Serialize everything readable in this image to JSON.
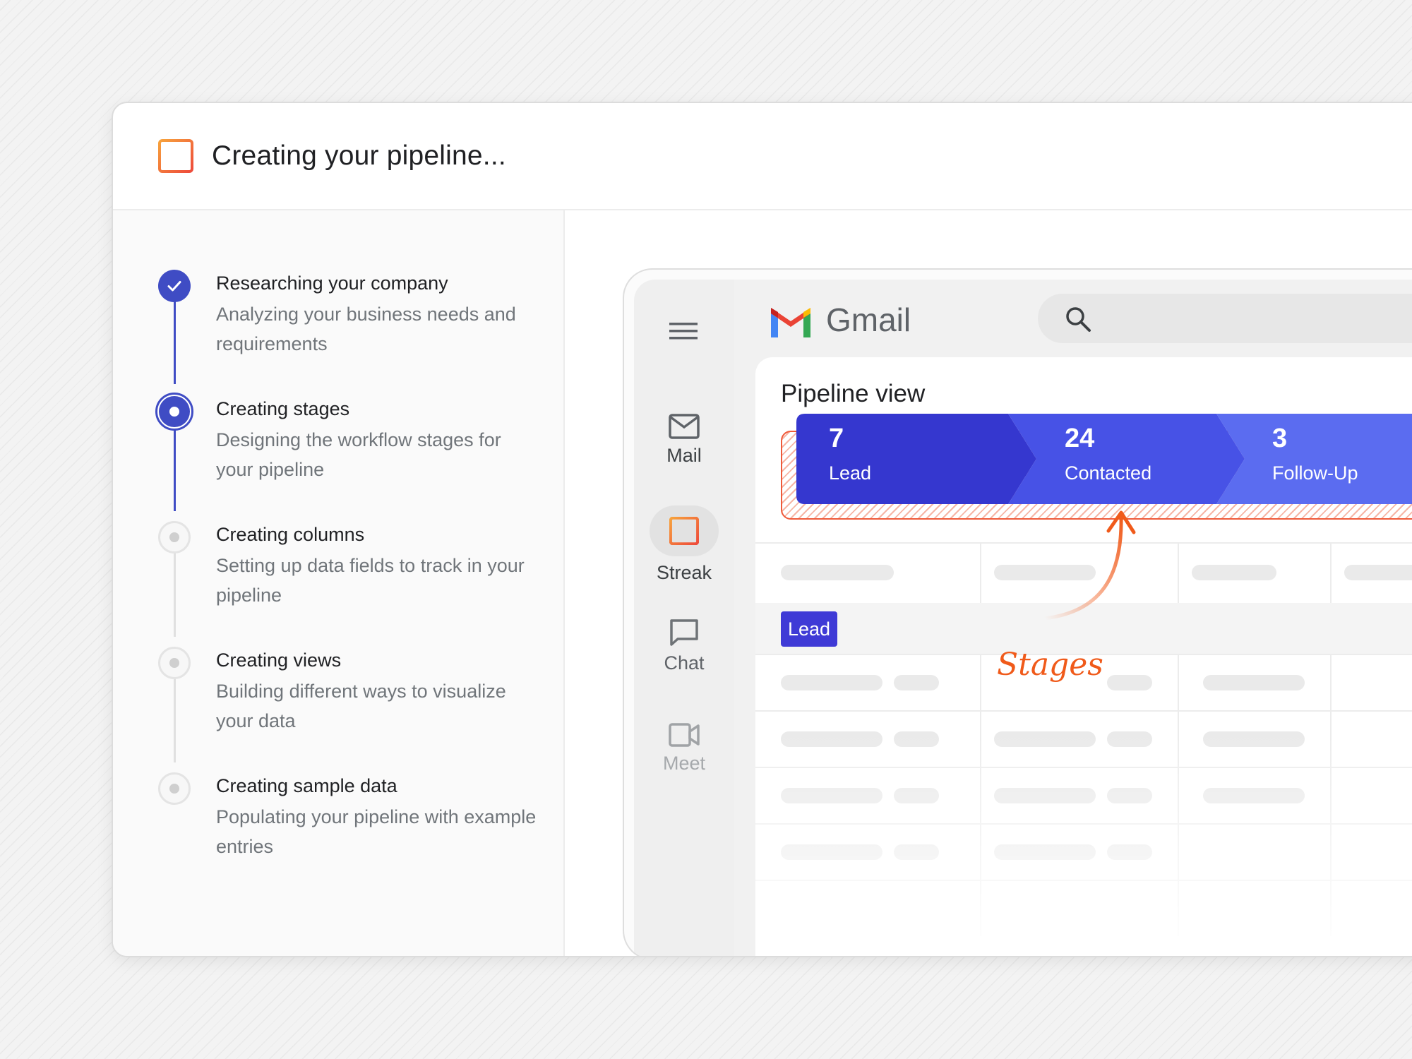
{
  "dialog": {
    "title": "Creating your pipeline..."
  },
  "steps": [
    {
      "title": "Researching your company",
      "description": "Analyzing your business needs and requirements",
      "status": "done"
    },
    {
      "title": "Creating stages",
      "description": "Designing the workflow stages for your pipeline",
      "status": "active"
    },
    {
      "title": "Creating columns",
      "description": "Setting up data fields to track in your pipeline",
      "status": "pending"
    },
    {
      "title": "Creating views",
      "description": "Building different ways to visualize your data",
      "status": "pending"
    },
    {
      "title": "Creating sample data",
      "description": "Populating your pipeline with example entries",
      "status": "pending"
    }
  ],
  "gmail": {
    "brand": "Gmail",
    "rail": [
      {
        "label": "Mail",
        "icon": "mail-icon"
      },
      {
        "label": "Streak",
        "icon": "streak-icon"
      },
      {
        "label": "Chat",
        "icon": "chat-icon"
      },
      {
        "label": "Meet",
        "icon": "meet-icon"
      }
    ],
    "pipeline_title": "Pipeline view",
    "stages": [
      {
        "count": "7",
        "label": "Lead",
        "color": "#3537cf"
      },
      {
        "count": "24",
        "label": "Contacted",
        "color": "#4752e6"
      },
      {
        "count": "3",
        "label": "Follow-Up",
        "color": "#5b6cf0"
      }
    ],
    "group_badge": "Lead",
    "annotation": "Stages"
  },
  "colors": {
    "accent": "#3f4cc4",
    "streak_orange": "#f26b3a",
    "annotation": "#f05a1a"
  }
}
